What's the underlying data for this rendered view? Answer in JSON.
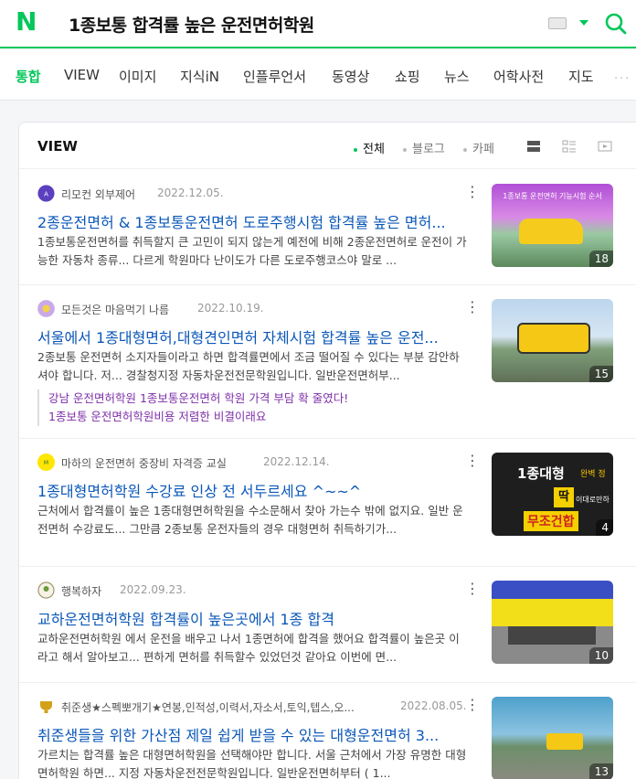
{
  "header": {
    "logo": "N",
    "query": "1종보통 합격률 높은 운전면허학원"
  },
  "tabs": [
    {
      "label": "통합"
    },
    {
      "label": "VIEW"
    },
    {
      "label": "이미지"
    },
    {
      "label": "지식iN"
    },
    {
      "label": "인플루언서"
    },
    {
      "label": "동영상"
    },
    {
      "label": "쇼핑"
    },
    {
      "label": "뉴스"
    },
    {
      "label": "어학사전"
    },
    {
      "label": "지도"
    }
  ],
  "more": "···",
  "view": {
    "title": "VIEW",
    "filters": [
      {
        "label": "전체"
      },
      {
        "label": "블로그"
      },
      {
        "label": "카페"
      }
    ]
  },
  "items": [
    {
      "author": "리모컨 외부제어",
      "date": "2022.12.05.",
      "title": "2종운전면허 & 1종보통운전면허 도로주행시험 합격률 높은 면허...",
      "desc": "1종보통운전면허를 취득할지 큰 고민이 되지 않는게 예전에 비해 2종운전면허로 운전이 가능한 자동차 종류... 다르게 학원마다 난이도가 다른 도로주행코스야 말로 ...",
      "count": "18",
      "thumb_text": "1종보통 운전면허 기능시험 순서"
    },
    {
      "author": "모든것은 마음먹기 나름",
      "date": "2022.10.19.",
      "title": "서울에서 1종대형면허,대형견인면허 자체시험 합격률 높은 운전...",
      "desc": "2종보통 운전면허 소지자들이라고 하면 합격률면에서 조금 떨어질 수 있다는 부분 감안하셔야 합니다. 저... 경찰청지정 자동차운전전문학원입니다. 일반운전면허부...",
      "count": "15",
      "subs": [
        "강남 운전면허학원 1종보통운전면허 학원 가격 부담 확 줄였다!",
        "1종보통 운전면허학원비용 저렴한 비결이래요"
      ]
    },
    {
      "author": "마하의 운전면허 중장비 자격증 교실",
      "date": "2022.12.14.",
      "title": "1종대형면허학원 수강료 인상 전 서두르세요 ^~~^",
      "desc": "근처에서 합격률이 높은 1종대형면허학원을 수소문해서 찾아 가는수 밖에 없지요. 일반 운전면허 수강료도... 그만큼 2종보통 운전자들의 경우 대형면허 취득하기가...",
      "count": "4",
      "thumb_text": "1종대형",
      "thumb_text2": "완벽 정",
      "thumb_text3": "딱",
      "thumb_text4": "이대로만하",
      "thumb_text5": "무조건합"
    },
    {
      "author": "행복하자",
      "date": "2022.09.23.",
      "title": "교하운전면허학원 합격률이 높은곳에서 1종 합격",
      "desc": "교하운전면허학원 에서 운전을 배우고 나서 1종면허에 합격을 했어요 합격률이 높은곳 이라고 해서 알아보고... 편하게 면허를 취득할수 있었던것 같아요 이번에 면...",
      "count": "10"
    },
    {
      "author": "취준생★스펙뽀개기★연봉,인적성,이력서,자소서,토익,텝스,오...",
      "date": "2022.08.05.",
      "title": "취준생들을 위한 가산점 제일 쉽게 받을 수 있는 대형운전면허 3...",
      "desc": "가르치는 합격률 높은 대형면허학원을 선택해야만 합니다. 서울 근처에서 가장 유명한 대형면허학원 하면... 지정 자동차운전전문학원입니다. 일반운전면허부터 ( 1...",
      "count": "13"
    }
  ]
}
